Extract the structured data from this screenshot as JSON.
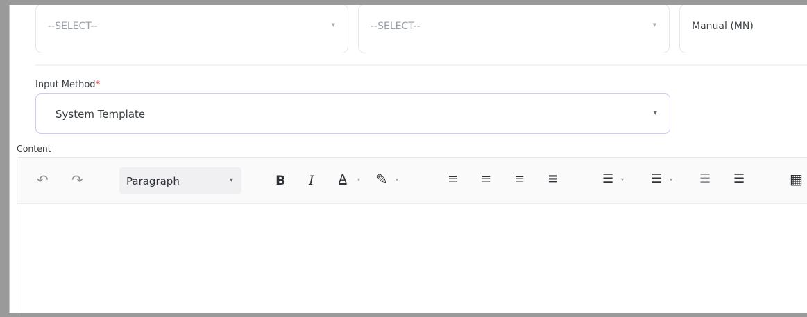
{
  "selects": {
    "select1": {
      "value": "--SELECT--"
    },
    "select2": {
      "value": "--SELECT--"
    },
    "select3": {
      "value": "Manual (MN)"
    }
  },
  "input_method": {
    "label": "Input Method",
    "required_mark": "*",
    "value": "System Template"
  },
  "content": {
    "label": "Content",
    "toolbar": {
      "undo_icon": "↶",
      "redo_icon": "↷",
      "paragraph_label": "Paragraph",
      "bold": "B",
      "italic": "I",
      "font_color": "A",
      "highlight_icon": "✎",
      "align_left_icon": "≡",
      "align_center_icon": "≡",
      "align_right_icon": "≡",
      "justify_icon": "≡",
      "bulleted_list_icon": "☰",
      "numbered_list_icon": "☰",
      "outdent_icon": "☰",
      "indent_icon": "☰",
      "table_icon": "▦",
      "dropdown_caret": "▾",
      "select_caret": "▼"
    }
  }
}
